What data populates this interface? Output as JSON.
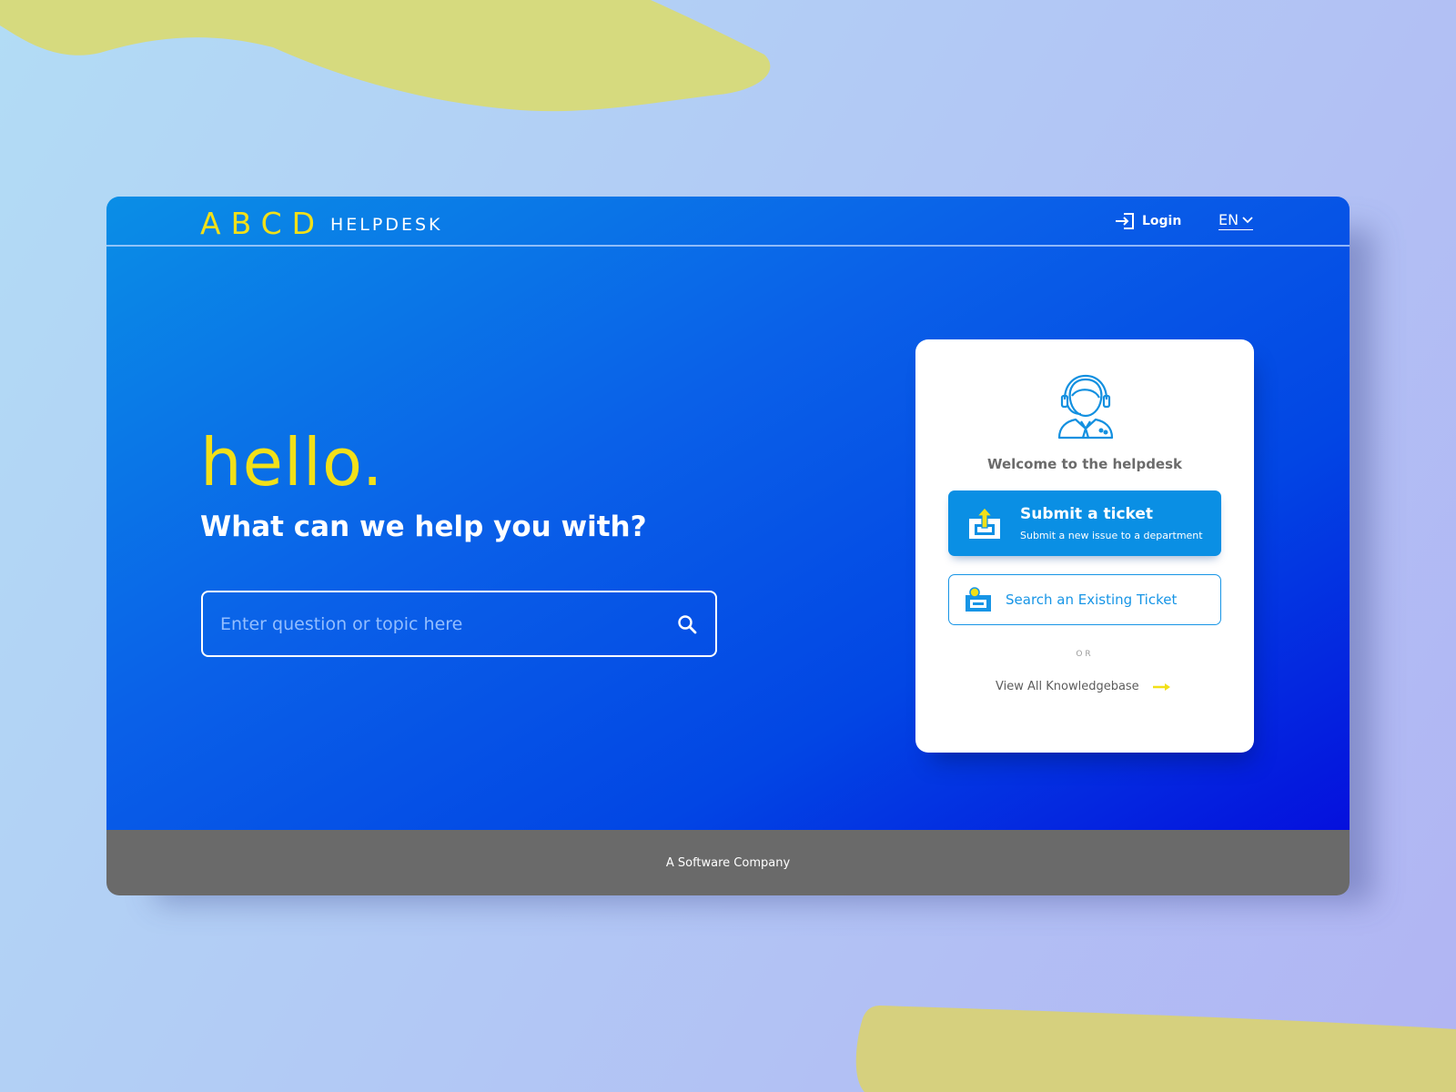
{
  "colors": {
    "accent_yellow": "#f2e018",
    "hero_blue": "#0a60e8",
    "button_blue": "#0a8fe4",
    "footer_gray": "#6a6a6a"
  },
  "header": {
    "logo_mark": "ABCD",
    "logo_text": "HELPDESK",
    "login_label": "Login",
    "login_icon": "login-arrow-icon",
    "language": "EN"
  },
  "hero": {
    "greeting": "hello.",
    "subheading": "What can we help you with?"
  },
  "search": {
    "placeholder": "Enter question or topic here",
    "value": "",
    "icon": "search-icon"
  },
  "card": {
    "icon": "support-agent-icon",
    "welcome": "Welcome to the helpdesk",
    "submit_ticket": {
      "title": "Submit a ticket",
      "subtitle": "Submit a new issue to a department",
      "icon": "upload-ticket-icon"
    },
    "existing_ticket": {
      "label": "Search an Existing Ticket",
      "icon": "ticket-search-icon"
    },
    "or_text": "OR",
    "knowledgebase_link": "View All Knowledgebase",
    "knowledgebase_icon": "arrow-right-icon"
  },
  "footer": {
    "text": "A Software Company"
  }
}
